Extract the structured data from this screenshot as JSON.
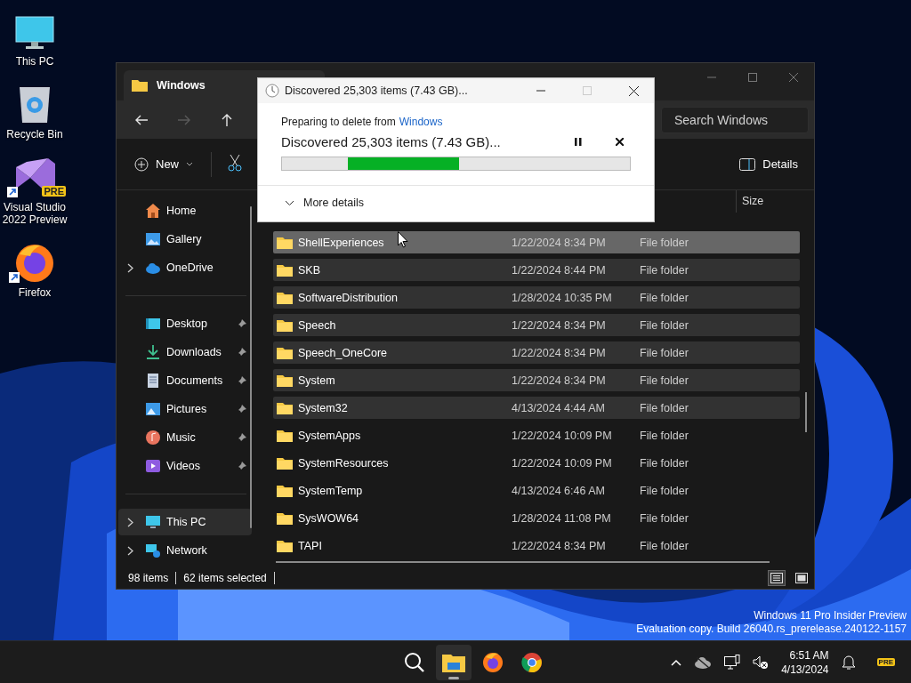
{
  "desktop_icons": [
    {
      "label": "This PC",
      "kind": "pc",
      "shortcut": false
    },
    {
      "label": "Recycle Bin",
      "kind": "bin",
      "shortcut": false
    },
    {
      "label": "Visual Studio 2022 Preview",
      "kind": "vs",
      "shortcut": true,
      "badge": "PRE"
    },
    {
      "label": "Firefox",
      "kind": "firefox",
      "shortcut": true
    }
  ],
  "explorer": {
    "tab": {
      "title": "Windows"
    },
    "navigation": [
      {
        "kind": "back",
        "disabled": false
      },
      {
        "kind": "forward",
        "disabled": true
      },
      {
        "kind": "up",
        "disabled": false
      }
    ],
    "search": {
      "placeholder": "Search Windows"
    },
    "toolbar": {
      "new_label": "New",
      "details_label": "Details"
    },
    "sidebar": {
      "sections": [
        [
          {
            "label": "Home",
            "kind": "home",
            "pinned": false,
            "expandable": false,
            "selected": false
          },
          {
            "label": "Gallery",
            "kind": "gallery",
            "pinned": false,
            "expandable": false,
            "selected": false
          },
          {
            "label": "OneDrive",
            "kind": "cloud",
            "pinned": false,
            "expandable": true,
            "selected": false
          }
        ],
        [
          {
            "label": "Desktop",
            "kind": "desktop",
            "pinned": true,
            "expandable": false,
            "selected": false
          },
          {
            "label": "Downloads",
            "kind": "downloads",
            "pinned": true,
            "expandable": false,
            "selected": false
          },
          {
            "label": "Documents",
            "kind": "documents",
            "pinned": true,
            "expandable": false,
            "selected": false
          },
          {
            "label": "Pictures",
            "kind": "pictures",
            "pinned": true,
            "expandable": false,
            "selected": false
          },
          {
            "label": "Music",
            "kind": "music",
            "pinned": true,
            "expandable": false,
            "selected": false
          },
          {
            "label": "Videos",
            "kind": "videos",
            "pinned": true,
            "expandable": false,
            "selected": false
          }
        ],
        [
          {
            "label": "This PC",
            "kind": "pc",
            "pinned": false,
            "expandable": true,
            "selected": true
          },
          {
            "label": "Network",
            "kind": "network",
            "pinned": false,
            "expandable": true,
            "selected": false
          }
        ]
      ]
    },
    "table": {
      "size_header": "Size",
      "rows": [
        {
          "name": "ShellExperiences",
          "date": "1/22/2024 8:34 PM",
          "type": "File folder",
          "selected": true,
          "hovered": true
        },
        {
          "name": "SKB",
          "date": "1/22/2024 8:44 PM",
          "type": "File folder",
          "selected": true,
          "hovered": false
        },
        {
          "name": "SoftwareDistribution",
          "date": "1/28/2024 10:35 PM",
          "type": "File folder",
          "selected": true,
          "hovered": false
        },
        {
          "name": "Speech",
          "date": "1/22/2024 8:34 PM",
          "type": "File folder",
          "selected": true,
          "hovered": false
        },
        {
          "name": "Speech_OneCore",
          "date": "1/22/2024 8:34 PM",
          "type": "File folder",
          "selected": true,
          "hovered": false
        },
        {
          "name": "System",
          "date": "1/22/2024 8:34 PM",
          "type": "File folder",
          "selected": true,
          "hovered": false
        },
        {
          "name": "System32",
          "date": "4/13/2024 4:44 AM",
          "type": "File folder",
          "selected": true,
          "hovered": false
        },
        {
          "name": "SystemApps",
          "date": "1/22/2024 10:09 PM",
          "type": "File folder",
          "selected": false,
          "hovered": false
        },
        {
          "name": "SystemResources",
          "date": "1/22/2024 10:09 PM",
          "type": "File folder",
          "selected": false,
          "hovered": false
        },
        {
          "name": "SystemTemp",
          "date": "4/13/2024 6:46 AM",
          "type": "File folder",
          "selected": false,
          "hovered": false
        },
        {
          "name": "SysWOW64",
          "date": "1/28/2024 11:08 PM",
          "type": "File folder",
          "selected": false,
          "hovered": false
        },
        {
          "name": "TAPI",
          "date": "1/22/2024 8:34 PM",
          "type": "File folder",
          "selected": false,
          "hovered": false
        }
      ]
    },
    "status_bar": {
      "item_count": "98 items",
      "selection": "62 items selected",
      "views": [
        {
          "kind": "details",
          "selected": true
        },
        {
          "kind": "tiles",
          "selected": false
        }
      ]
    }
  },
  "dialog": {
    "title": "Discovered 25,303 items (7.43 GB)...",
    "source_prefix": "Preparing to delete from",
    "source_link": "Windows",
    "status": "Discovered 25,303 items (7.43 GB)...",
    "progress": {
      "kind": "marquee",
      "level": 0.32
    },
    "more_details": "More details"
  },
  "watermark": [
    "Windows 11 Pro Insider Preview",
    "Evaluation copy. Build 26040.rs_prerelease.240122-1157"
  ],
  "taskbar": {
    "apps": [
      {
        "kind": "search",
        "active": false
      },
      {
        "kind": "explorer",
        "active": true
      },
      {
        "kind": "firefox",
        "active": false
      },
      {
        "kind": "chrome",
        "active": false
      }
    ],
    "tray": {
      "time": "6:51 AM",
      "date": "4/13/2024",
      "badge": "PRE"
    }
  }
}
